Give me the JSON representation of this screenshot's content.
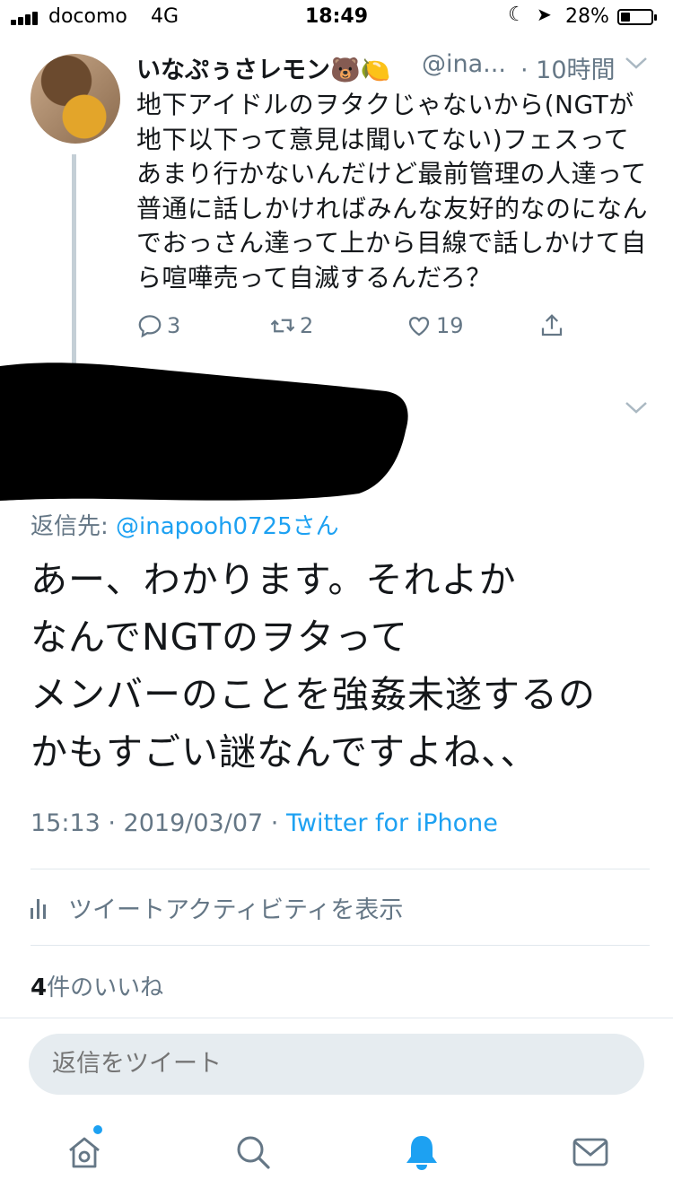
{
  "status_bar": {
    "carrier": "docomo",
    "network": "4G",
    "time": "18:49",
    "battery": "28%"
  },
  "parent_tweet": {
    "name": "いなぷぅさレモン🐻🍋",
    "handle": "@ina...",
    "time": "· 10時間",
    "text": "地下アイドルのヲタクじゃないから(NGTが地下以下って意見は聞いてない)フェスってあまり行かないんだけど最前管理の人達って普通に話しかければみんな友好的なのになんでおっさん達って上から目線で話しかけて自ら喧嘩売って自滅するんだろ？",
    "replies": "3",
    "retweets": "2",
    "likes": "19"
  },
  "main_tweet": {
    "reply_prefix": "返信先: ",
    "reply_handle": "@inapooh0725さん",
    "text_lines": [
      "あー、わかります。それよか",
      "なんでNGTのヲタって",
      "メンバーのことを強姦未遂するの",
      "かもすごい謎なんですよね、、"
    ],
    "time": "15:13 · 2019/03/07 · ",
    "source": "Twitter for iPhone",
    "activity_label": "ツイートアクティビティを表示",
    "likes_count": "4",
    "likes_label": "件のいいね"
  },
  "reply_bar": {
    "placeholder": "返信をツイート"
  },
  "tabs": [
    "home-icon",
    "search-icon",
    "notifications-icon",
    "messages-icon"
  ],
  "colors": {
    "accent": "#1da1f2",
    "secondary_text": "#657786",
    "divider": "#e1e8ed"
  }
}
